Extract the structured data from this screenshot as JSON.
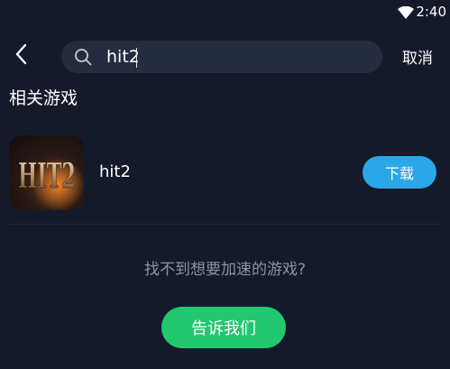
{
  "status_bar": {
    "time": "2:40",
    "wifi_icon": "wifi-icon"
  },
  "header": {
    "back_icon": "chevron-left-icon",
    "search": {
      "icon": "search-icon",
      "value": "hit2",
      "placeholder": ""
    },
    "cancel_label": "取消"
  },
  "section_title": "相关游戏",
  "results": [
    {
      "name": "hit2",
      "icon_text": "HIT2",
      "action_label": "下载"
    }
  ],
  "footer": {
    "not_found_text": "找不到想要加速的游戏?",
    "tell_us_label": "告诉我们"
  },
  "colors": {
    "background": "#151a2b",
    "search_bg": "#252c40",
    "download_button": "#2aa7e6",
    "tell_us_button": "#22c86f",
    "muted_text": "#8c93a3"
  }
}
